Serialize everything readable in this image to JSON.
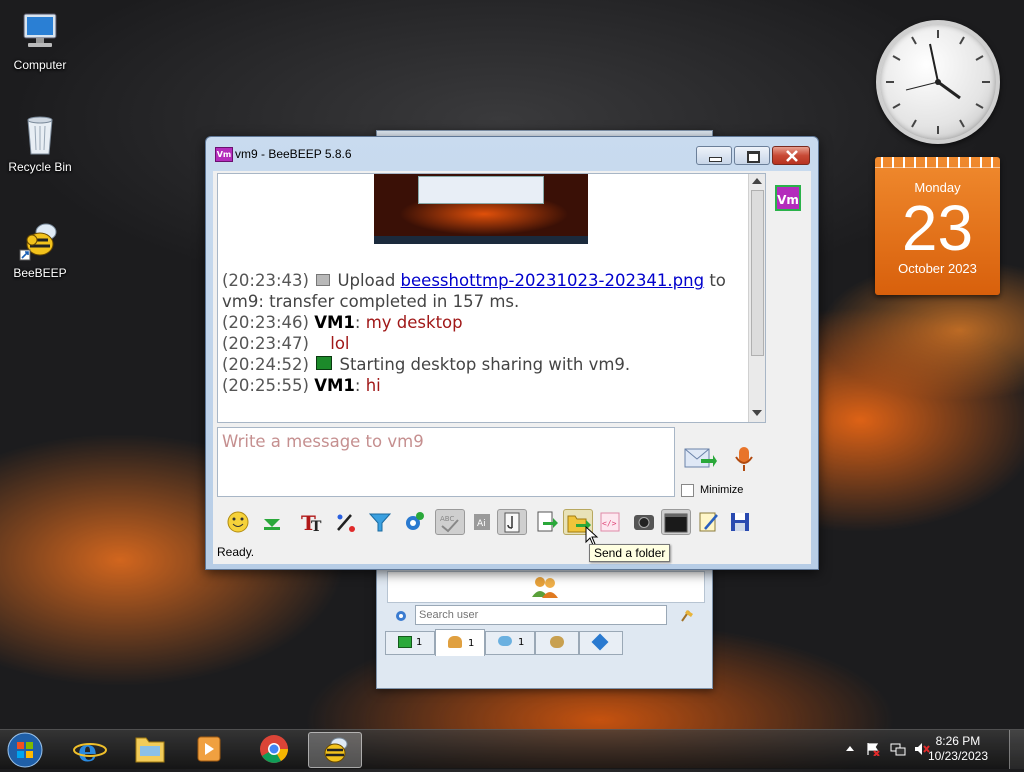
{
  "desktop": {
    "icons": [
      {
        "label": "Computer"
      },
      {
        "label": "Recycle Bin"
      },
      {
        "label": "BeeBEEP"
      }
    ]
  },
  "calendar": {
    "weekday": "Monday",
    "day": "23",
    "month_year": "October 2023"
  },
  "window": {
    "title": "vm9 - BeeBEEP 5.8.6",
    "app_icon": "Vm",
    "peer_badge": "Vm",
    "chat": {
      "messages": [
        {
          "time": "(20:23:43)",
          "pre": "Upload ",
          "link": "beesshottmp-20231023-202341.png",
          "post": " to"
        },
        {
          "continuation": "vm9: transfer completed in 157 ms."
        },
        {
          "time": "(20:23:46)",
          "nick": "VM1",
          "sep": ": ",
          "text": "my desktop"
        },
        {
          "time": "(20:23:47)",
          "text": "lol"
        },
        {
          "time": "(20:24:52)",
          "text": "Starting desktop sharing with vm9."
        },
        {
          "time": "(20:25:55)",
          "nick": "VM1",
          "sep": ": ",
          "text": "hi"
        }
      ]
    },
    "input_placeholder": "Write a message to vm9",
    "minimize_label": "Minimize",
    "status": "Ready.",
    "tooltip": "Send a folder",
    "toolbar_icons": [
      "emoticon-icon",
      "green-arrow-icon",
      "font-icon",
      "color-picker-icon",
      "filter-icon",
      "settings-icon",
      "spellcheck-icon",
      "word-complete-icon",
      "file-sharing-icon",
      "send-file-icon",
      "send-folder-icon",
      "code-icon",
      "screenshot-icon",
      "terminal-icon",
      "notes-icon",
      "save-icon"
    ]
  },
  "buddy_window": {
    "search_placeholder": "Search user",
    "tabs": [
      {
        "icon": "chat-icon",
        "count": "1"
      },
      {
        "icon": "users-icon",
        "count": "1"
      },
      {
        "icon": "conversations-icon",
        "count": "1"
      },
      {
        "icon": "groups-icon",
        "count": ""
      },
      {
        "icon": "share-icon",
        "count": ""
      }
    ]
  },
  "taskbar": {
    "time": "8:26 PM",
    "date": "10/23/2023"
  },
  "colors": {
    "accent": "#b42cbc",
    "nick": "#000000",
    "message": "#a01818",
    "link": "#0000cc"
  }
}
